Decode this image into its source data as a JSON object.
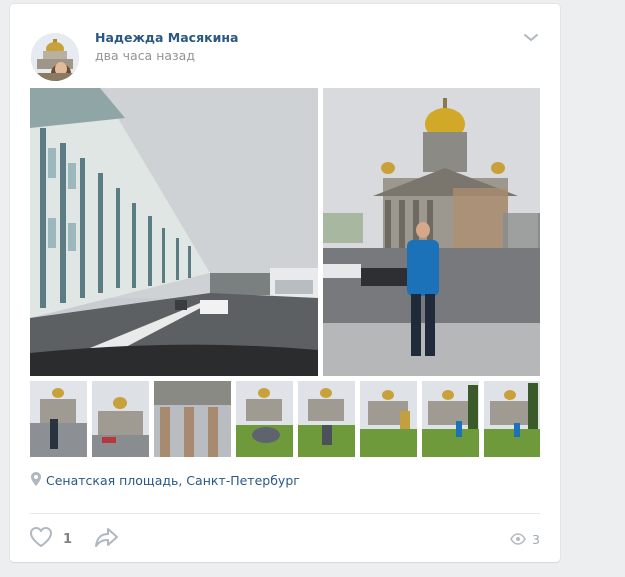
{
  "post": {
    "author": "Надежда Масякина",
    "time": "два часа назад",
    "location": "Сенатская площадь, Санкт-Петербург",
    "likes": "1",
    "views": "3"
  },
  "icons": {
    "more": "chevron-down-icon",
    "geo": "map-pin-icon",
    "like": "heart-icon",
    "share": "share-arrow-icon",
    "views": "eye-icon"
  },
  "colors": {
    "link": "#2a5885",
    "secondary": "#939393",
    "icon": "#aeb7c2",
    "page_bg": "#edeef0"
  },
  "photos": {
    "large": [
      "Winter Palace street",
      "St Isaac's Cathedral with man"
    ],
    "thumbnails": 8
  }
}
